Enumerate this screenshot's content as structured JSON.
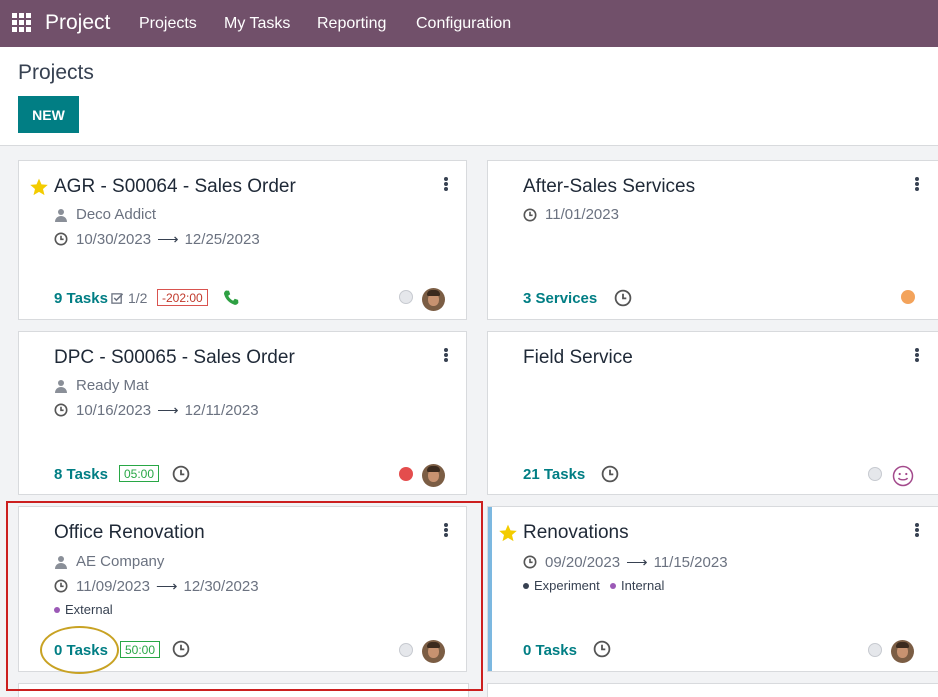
{
  "navbar": {
    "app_name": "Project",
    "menu": [
      "Projects",
      "My Tasks",
      "Reporting",
      "Configuration"
    ]
  },
  "control_panel": {
    "title": "Projects",
    "new_button": "NEW"
  },
  "colors": {
    "navbar": "#71506a",
    "primary": "#017e84",
    "star": "#f3cc00",
    "status_red": "#e44d4d",
    "status_orange": "#f3a35b",
    "status_grey": "#e5e7eb",
    "highlight_red": "#cc1f1f",
    "highlight_gold": "#c8a223"
  },
  "cards": [
    {
      "title": "AGR - S00064 - Sales Order",
      "favorite": true,
      "customer": "Deco Addict",
      "date_start": "10/30/2023",
      "date_end": "12/25/2023",
      "tasks_count": "9",
      "tasks_label": "Tasks",
      "milestones": "1/2",
      "time_badge": "-202:00",
      "has_phone_icon": true,
      "status": "grey",
      "has_avatar": true
    },
    {
      "title": "After-Sales Services",
      "favorite": false,
      "date_start": "11/01/2023",
      "tasks_count": "3",
      "tasks_label": "Services",
      "status": "orange",
      "has_avatar": false
    },
    {
      "title": "DPC - S00065 - Sales Order",
      "favorite": false,
      "customer": "Ready Mat",
      "date_start": "10/16/2023",
      "date_end": "12/11/2023",
      "tasks_count": "8",
      "tasks_label": "Tasks",
      "time_badge": "05:00",
      "status": "red",
      "has_avatar": true
    },
    {
      "title": "Field Service",
      "favorite": false,
      "tasks_count": "21",
      "tasks_label": "Tasks",
      "status": "grey",
      "has_avatar": false,
      "smiley": true
    },
    {
      "title": "Office Renovation",
      "favorite": false,
      "customer": "AE Company",
      "date_start": "11/09/2023",
      "date_end": "12/30/2023",
      "tags": [
        {
          "name": "External",
          "color": "#9b59b6"
        }
      ],
      "tasks_count": "0",
      "tasks_label": "Tasks",
      "time_badge": "50:00",
      "status": "grey",
      "has_avatar": true
    },
    {
      "title": "Renovations",
      "favorite": true,
      "date_start": "09/20/2023",
      "date_end": "11/15/2023",
      "tags": [
        {
          "name": "Experiment",
          "color": "#374151"
        },
        {
          "name": "Internal",
          "color": "#9b59b6"
        }
      ],
      "tasks_count": "0",
      "tasks_label": "Tasks",
      "status": "grey",
      "has_avatar": true
    }
  ]
}
